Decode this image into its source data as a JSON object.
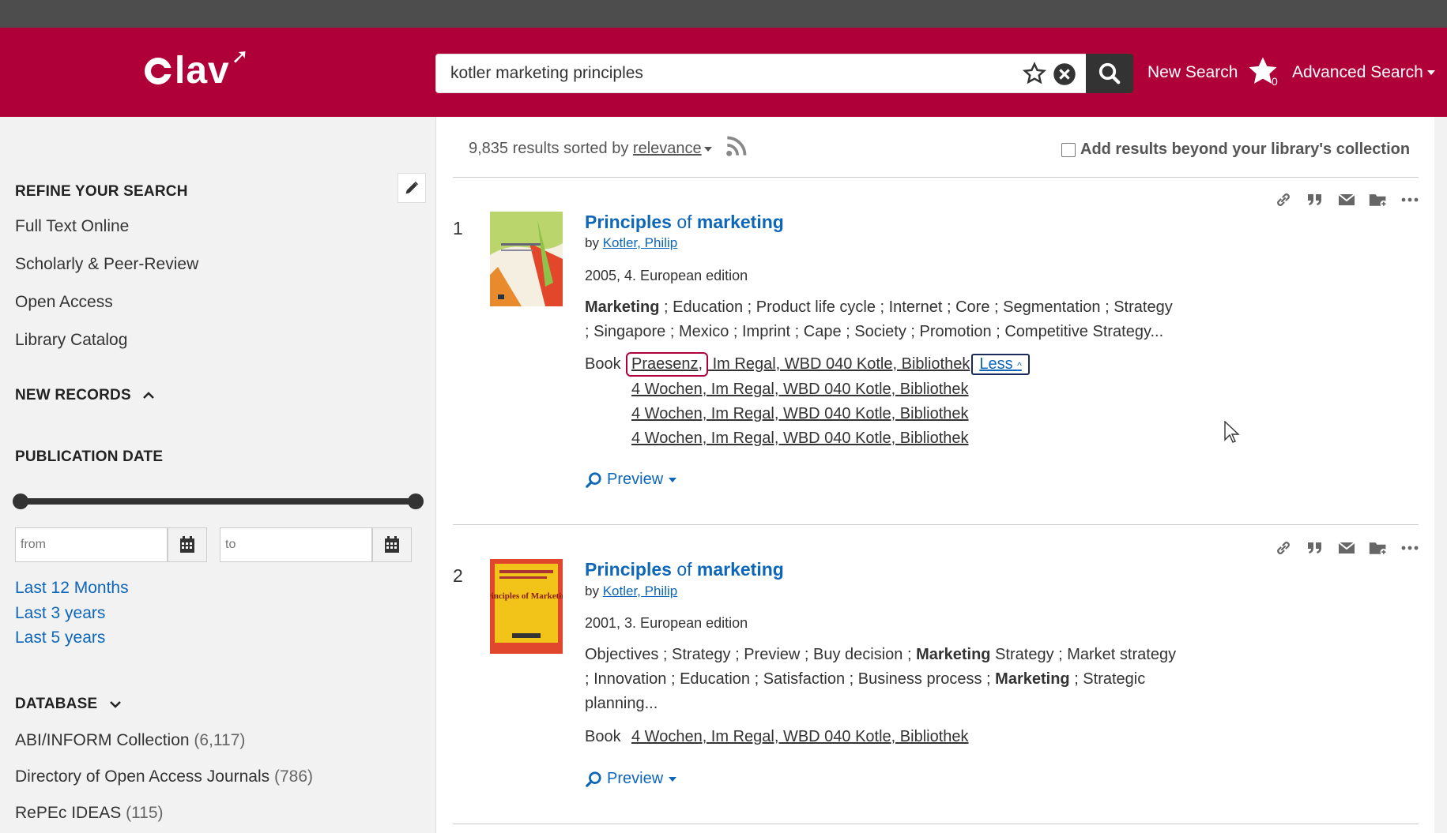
{
  "header": {
    "logo": "lav",
    "search_value": "kotler marketing principles",
    "new_search": "New Search",
    "favorites_count": "0",
    "advanced_search": "Advanced Search"
  },
  "sidebar": {
    "refine_heading": "REFINE YOUR SEARCH",
    "refine_items": [
      "Full Text Online",
      "Scholarly & Peer-Review",
      "Open Access",
      "Library Catalog"
    ],
    "new_records": "NEW RECORDS",
    "publication_date": "PUBLICATION DATE",
    "from_placeholder": "from",
    "to_placeholder": "to",
    "quick_dates": [
      "Last 12 Months",
      "Last 3 years",
      "Last 5 years"
    ],
    "database_heading": "DATABASE",
    "databases": [
      {
        "name": "ABI/INFORM Collection",
        "count": "(6,117)"
      },
      {
        "name": "Directory of Open Access Journals",
        "count": "(786)"
      },
      {
        "name": "RePEc IDEAS",
        "count": "(115)"
      }
    ]
  },
  "results_bar": {
    "count_text": "9,835 results sorted by",
    "sort": "relevance",
    "beyond_label": "Add results beyond your library's collection"
  },
  "results": [
    {
      "num": "1",
      "title_a": "Principles",
      "title_of": "of",
      "title_b": "marketing",
      "by": "by",
      "author": "Kotler, Philip",
      "edition": "2005, 4. European edition",
      "subjects_line1_bold": "Marketing",
      "subjects_line1": " ; Education ; Product life cycle ; Internet ; Core ; Segmentation ; Strategy",
      "subjects_line2": "; Singapore ; Mexico ; Imprint ; Cape ; Society ; Promotion ; Competitive Strategy...",
      "type": "Book",
      "holding_highlight": "Praesenz,",
      "holding_first_rest": " Im Regal, WBD 040 Kotle, Bibliothek",
      "less": "Less",
      "holdings": [
        "4 Wochen, Im Regal, WBD 040 Kotle, Bibliothek",
        "4 Wochen, Im Regal, WBD 040 Kotle, Bibliothek",
        "4 Wochen, Im Regal, WBD 040 Kotle, Bibliothek"
      ],
      "preview": "Preview"
    },
    {
      "num": "2",
      "title_a": "Principles",
      "title_of": "of",
      "title_b": "marketing",
      "by": "by",
      "author": "Kotler, Philip",
      "edition": "2001, 3. European edition",
      "subjects_l1_a": "Objectives ; Strategy ; Preview ; Buy decision ; ",
      "subjects_l1_b": "Marketing",
      "subjects_l1_c": " Strategy ; Market strategy",
      "subjects_l2_a": "; Innovation ; Education ; Satisfaction ; Business process ; ",
      "subjects_l2_b": "Marketing",
      "subjects_l2_c": " ; Strategic",
      "subjects_l3": "planning...",
      "type": "Book",
      "holding": "4 Wochen, Im Regal, WBD 040 Kotle, Bibliothek",
      "preview": "Preview",
      "cover_title": "Principles of Marketing"
    }
  ],
  "colors": {
    "brand": "#b0003a",
    "link": "#0d66b8"
  }
}
